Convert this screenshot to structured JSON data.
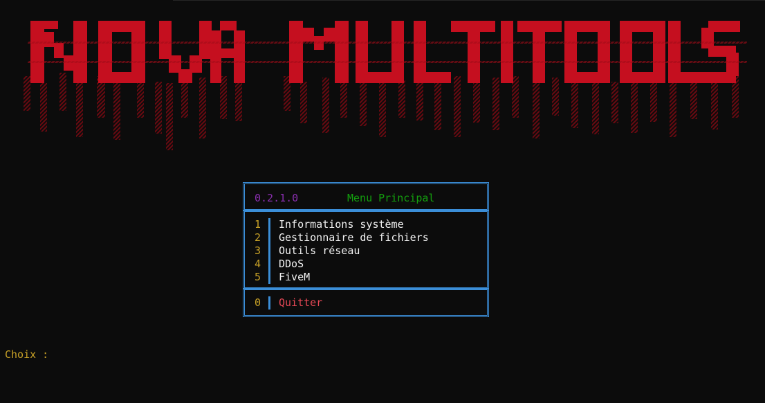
{
  "banner": {
    "text": "NOVA MULTITOOLS",
    "color": "#c50f1f"
  },
  "menu": {
    "version": "0.2.1.0",
    "title": "Menu Principal",
    "items": [
      {
        "number": "1",
        "label": "Informations système"
      },
      {
        "number": "2",
        "label": "Gestionnaire de fichiers"
      },
      {
        "number": "3",
        "label": "Outils réseau"
      },
      {
        "number": "4",
        "label": "DDoS"
      },
      {
        "number": "5",
        "label": "FiveM"
      }
    ],
    "quit": {
      "number": "0",
      "label": "Quitter"
    }
  },
  "prompt": {
    "label": "Choix :"
  },
  "colors": {
    "background": "#0c0c0c",
    "border": "#3b8ed8",
    "number": "#c9a227",
    "version": "#8a2fb0",
    "title": "#13a10e",
    "quit": "#e74856"
  }
}
